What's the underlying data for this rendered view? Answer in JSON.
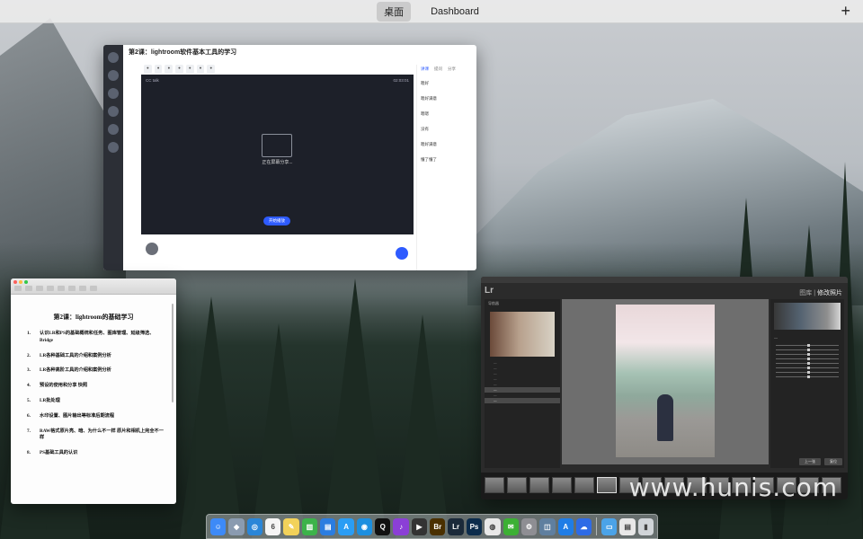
{
  "menubar": {
    "spaces": [
      "桌面",
      "Dashboard"
    ],
    "add_label": "+"
  },
  "classroom": {
    "title": "第2课：lightroom软件基本工具的学习",
    "vhead": "CC talk",
    "vtime": "02:03:01",
    "loading": "正在屏幕分享...",
    "start_label": "开始播放",
    "tabs": [
      "讲课",
      "提问",
      "分享"
    ],
    "chat": [
      {
        "msg": "嗯好"
      },
      {
        "msg": "嗯好满意"
      },
      {
        "msg": "嗯嗯"
      },
      {
        "msg": "没有"
      },
      {
        "msg": "嗯好满意"
      },
      {
        "msg": "懂了懂了"
      }
    ]
  },
  "textedit": {
    "title": "第2课：lightroom的基础学习",
    "items": [
      {
        "n": "1.",
        "t": "认识LR和PS的基础概统和任务、图库管理、延级筛选、Bridge"
      },
      {
        "n": "2.",
        "t": "LR各种基础工具的介绍和案例分析"
      },
      {
        "n": "3.",
        "t": "LR各种高阶工具的介绍和案例分析"
      },
      {
        "n": "4.",
        "t": "预设的使用和分享  快照"
      },
      {
        "n": "5.",
        "t": "LR批处理"
      },
      {
        "n": "6.",
        "t": "水印设置、图片输出等标准后期流程"
      },
      {
        "n": "7.",
        "t": "RAW格式原片亮、暗、为什么不一样  原片和相机上完全不一样"
      },
      {
        "n": "8.",
        "t": "PS基础工具的认识"
      }
    ]
  },
  "lightroom": {
    "logo": "Lr",
    "modules_prefix": "图库 | ",
    "modules_current": "修改照片",
    "buttons": [
      "上一张",
      "复位"
    ],
    "nav_label": "导航器"
  },
  "watermark": "www.hunis.com",
  "dock": [
    {
      "name": "finder-icon",
      "color": "#3d8af7",
      "glyph": "☺"
    },
    {
      "name": "launchpad-icon",
      "color": "#8a9bb0",
      "glyph": "◆"
    },
    {
      "name": "safari-icon",
      "color": "#2a86d8",
      "glyph": "◎"
    },
    {
      "name": "calendar-icon",
      "color": "#f5f5f5",
      "glyph": "6"
    },
    {
      "name": "notes-icon",
      "color": "#f2d25a",
      "glyph": "✎"
    },
    {
      "name": "numbers-icon",
      "color": "#3cb34a",
      "glyph": "▥"
    },
    {
      "name": "keynote-icon",
      "color": "#2b7de0",
      "glyph": "▤"
    },
    {
      "name": "appstore-icon",
      "color": "#2a9df4",
      "glyph": "A"
    },
    {
      "name": "browser-icon",
      "color": "#1c8fe0",
      "glyph": "◉"
    },
    {
      "name": "qq-icon",
      "color": "#111111",
      "glyph": "Q"
    },
    {
      "name": "music-icon",
      "color": "#8b3fd6",
      "glyph": "♪"
    },
    {
      "name": "video-icon",
      "color": "#333333",
      "glyph": "▶"
    },
    {
      "name": "bridge-icon",
      "color": "#4a3000",
      "glyph": "Br"
    },
    {
      "name": "lightroom-icon",
      "color": "#1b2a3a",
      "glyph": "Lr"
    },
    {
      "name": "photoshop-icon",
      "color": "#0c2c4c",
      "glyph": "Ps"
    },
    {
      "name": "chrome-icon",
      "color": "#e8e8e8",
      "glyph": "◍"
    },
    {
      "name": "wechat-icon",
      "color": "#3cb034",
      "glyph": "✉"
    },
    {
      "name": "settings-icon",
      "color": "#8e8e93",
      "glyph": "⚙"
    },
    {
      "name": "preview-icon",
      "color": "#5f7f9f",
      "glyph": "◫"
    },
    {
      "name": "appstore2-icon",
      "color": "#1f7de6",
      "glyph": "A"
    },
    {
      "name": "baidu-icon",
      "color": "#2e6be6",
      "glyph": "☁"
    },
    {
      "name": "folder-icon",
      "color": "#4ba3e8",
      "glyph": "▭"
    },
    {
      "name": "documents-icon",
      "color": "#e8e8e8",
      "glyph": "▤"
    },
    {
      "name": "trash-icon",
      "color": "#d0d4d8",
      "glyph": "▮"
    }
  ]
}
